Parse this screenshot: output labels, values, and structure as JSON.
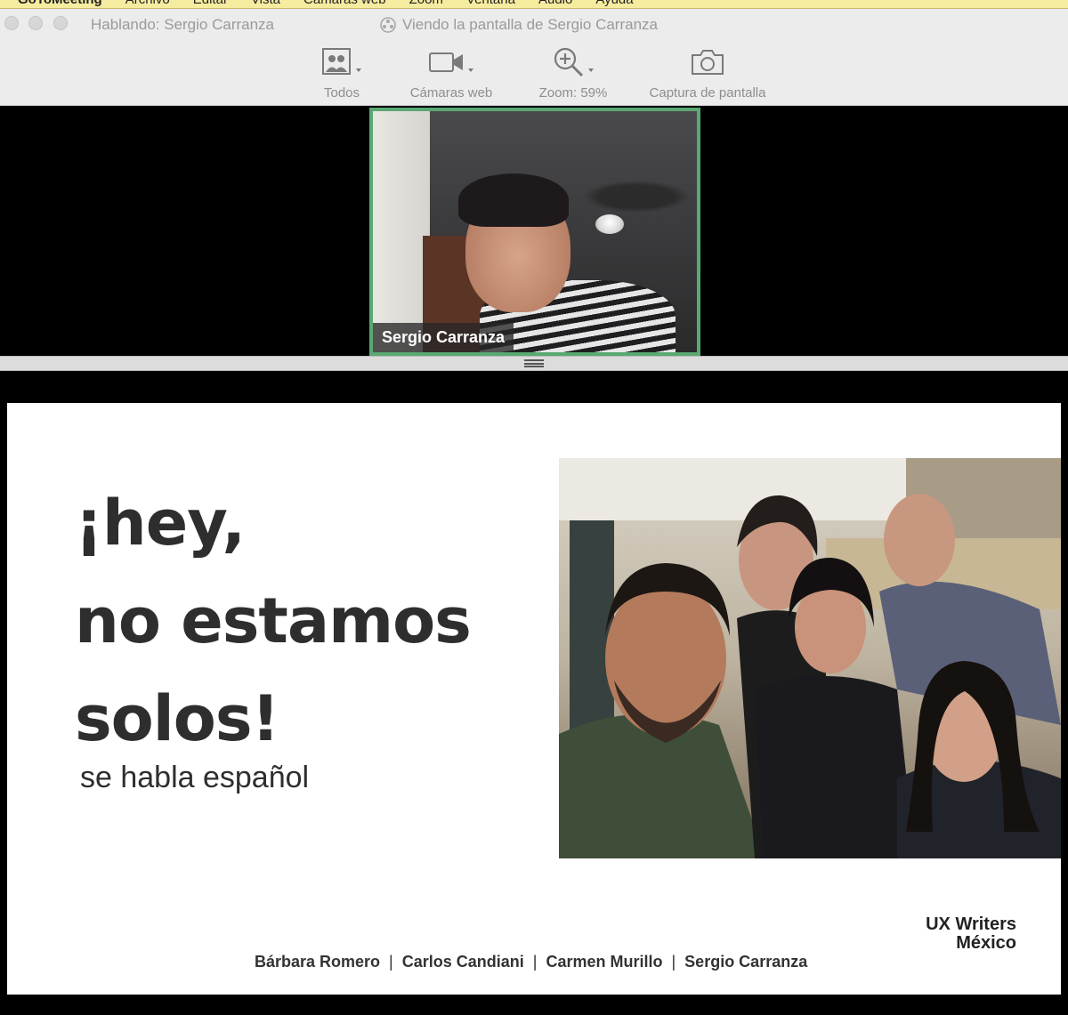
{
  "menubar": {
    "items": [
      "GoToMeeting",
      "Archivo",
      "Editar",
      "Vista",
      "Cámaras web",
      "Zoom",
      "Ventana",
      "Audio",
      "Ayuda"
    ]
  },
  "titlebar": {
    "speaking_text": "Hablando: Sergio Carranza",
    "viewing_text": "Viendo la pantalla de Sergio Carranza"
  },
  "toolbar": {
    "items": [
      {
        "label": "Todos",
        "icon": "participants-icon"
      },
      {
        "label": "Cámaras web",
        "icon": "webcam-icon"
      },
      {
        "label": "Zoom: 59%",
        "icon": "zoom-in-icon"
      },
      {
        "label": "Captura de pantalla",
        "icon": "camera-icon"
      }
    ]
  },
  "speaker": {
    "name": "Sergio Carranza",
    "active_color": "#5aa873"
  },
  "slide": {
    "headline_line1": "¡hey,",
    "headline_line2": "no estamos",
    "headline_line3": "solos!",
    "subtitle": "se habla español",
    "brand_line1": "UX Writers",
    "brand_line2": "México",
    "credits": [
      "Bárbara Romero",
      "Carlos Candiani",
      "Carmen Murillo",
      "Sergio Carranza"
    ],
    "separator": "|"
  }
}
